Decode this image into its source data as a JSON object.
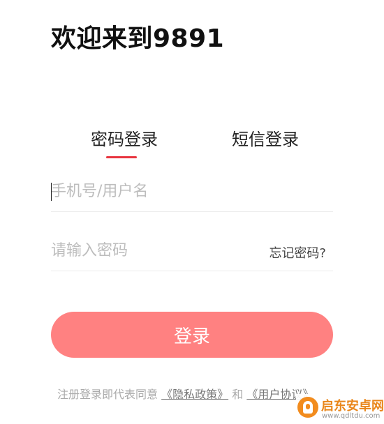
{
  "header": {
    "title": "欢迎来到9891"
  },
  "tabs": [
    {
      "label": "密码登录",
      "active": true
    },
    {
      "label": "短信登录",
      "active": false
    }
  ],
  "form": {
    "username_placeholder": "手机号/用户名",
    "username_value": "",
    "password_placeholder": "请输入密码",
    "password_value": "",
    "forgot_label": "忘记密码?"
  },
  "login_button": {
    "label": "登录"
  },
  "agreement": {
    "prefix": "注册登录即代表同意",
    "privacy_link": "《隐私政策》",
    "conjunction": "和",
    "user_link": "《用户协议》"
  },
  "watermark": {
    "name": "启东安卓网",
    "url": "www.qdltdu.com"
  },
  "colors": {
    "accent": "#e8343f",
    "button": "#ff8181",
    "placeholder": "#bdbdbd",
    "watermark": "#e9861a"
  }
}
